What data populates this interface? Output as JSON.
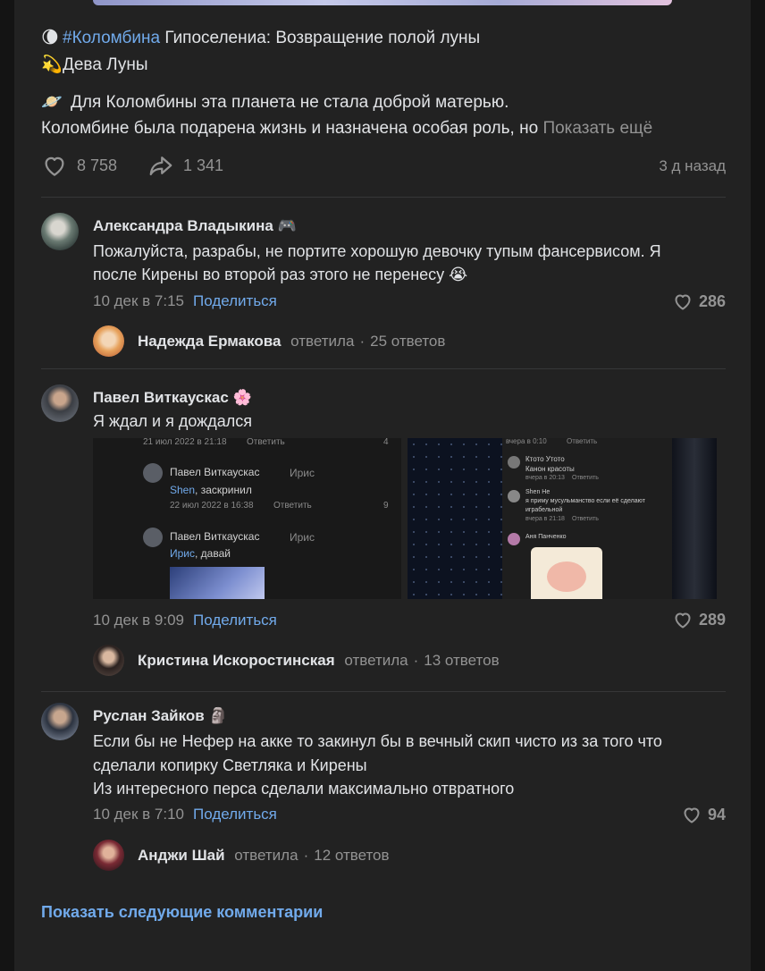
{
  "post": {
    "line1_emoji": "🌘",
    "line1_tag": "#Коломбина",
    "line1_text": " Гипоселениа: Возвращение полой луны",
    "line2_emoji": "💫",
    "line2_text": "Дева Луны",
    "line3_emoji": "🪐",
    "line3_text": "Для Коломбины эта планета не стала доброй матерью.",
    "line4_text": "Коломбине была подарена жизнь и назначена особая роль, но",
    "show_more": "Показать ещё",
    "likes": "8 758",
    "shares": "1 341",
    "date": "3 д назад"
  },
  "comments": [
    {
      "author": "Александра Владыкина",
      "badge": "🎮",
      "text_lines": [
        "Пожалуйста, разрабы, не портите хорошую девочку тупым фансервисом. Я",
        "после Кирены во второй раз этого не перенесу 😭"
      ],
      "time": "10 дек в 7:15",
      "share": "Поделиться",
      "likes": "286",
      "reply_name": "Надежда Ермакова",
      "reply_action": "ответила",
      "reply_count": "25 ответов"
    },
    {
      "author": "Павел Виткаускас",
      "badge": "🌸",
      "text_lines": [
        "Я ждал и я дождался"
      ],
      "time": "10 дек в 9:09",
      "share": "Поделиться",
      "likes": "289",
      "reply_name": "Кристина Искоростинская",
      "reply_action": "ответила",
      "reply_count": "13 ответов",
      "shot1": {
        "t1": "21 июл 2022 в 21:18",
        "t1b": "Ответить",
        "l1": "4",
        "n1": "Павел Виткаускас",
        "n1b": "Ирис",
        "m1a": "Shen",
        "m1b": ", заскринил",
        "t2": "22 июл 2022 в 16:38",
        "t2b": "Ответить",
        "l2": "9",
        "n2": "Павел Виткаускас",
        "n2b": "Ирис",
        "m2a": "Ирис",
        "m2b": ", давай"
      },
      "shot2": {
        "a1": "вчера в 0:10",
        "a1b": "Ответить",
        "b1": "Ктото Утото",
        "b2": "Канон красоты",
        "b3": "вчера в 20:13",
        "b3b": "Ответить",
        "c1": "Shen Не",
        "c2": "я приму мусульманство если её сделают",
        "c3": "играбельной",
        "c4": "вчера в 21:18",
        "c4b": "Ответить",
        "d1": "Аня Панченко"
      }
    },
    {
      "author": "Руслан Зайков",
      "badge": "🗿",
      "text_lines": [
        "Если бы не Нефер на акке то закинул бы в вечный скип чисто из за того что",
        "сделали копирку Светляка и Кирены",
        "Из интересного перса сделали максимально отвратного"
      ],
      "time": "10 дек в 7:10",
      "share": "Поделиться",
      "likes": "94",
      "reply_name": "Анджи Шай",
      "reply_action": "ответила",
      "reply_count": "12 ответов"
    }
  ],
  "show_next": "Показать следующие комментарии",
  "colors": {
    "accent": "#71aaeb",
    "muted": "#939393",
    "card": "#222222",
    "background": "#141414"
  }
}
